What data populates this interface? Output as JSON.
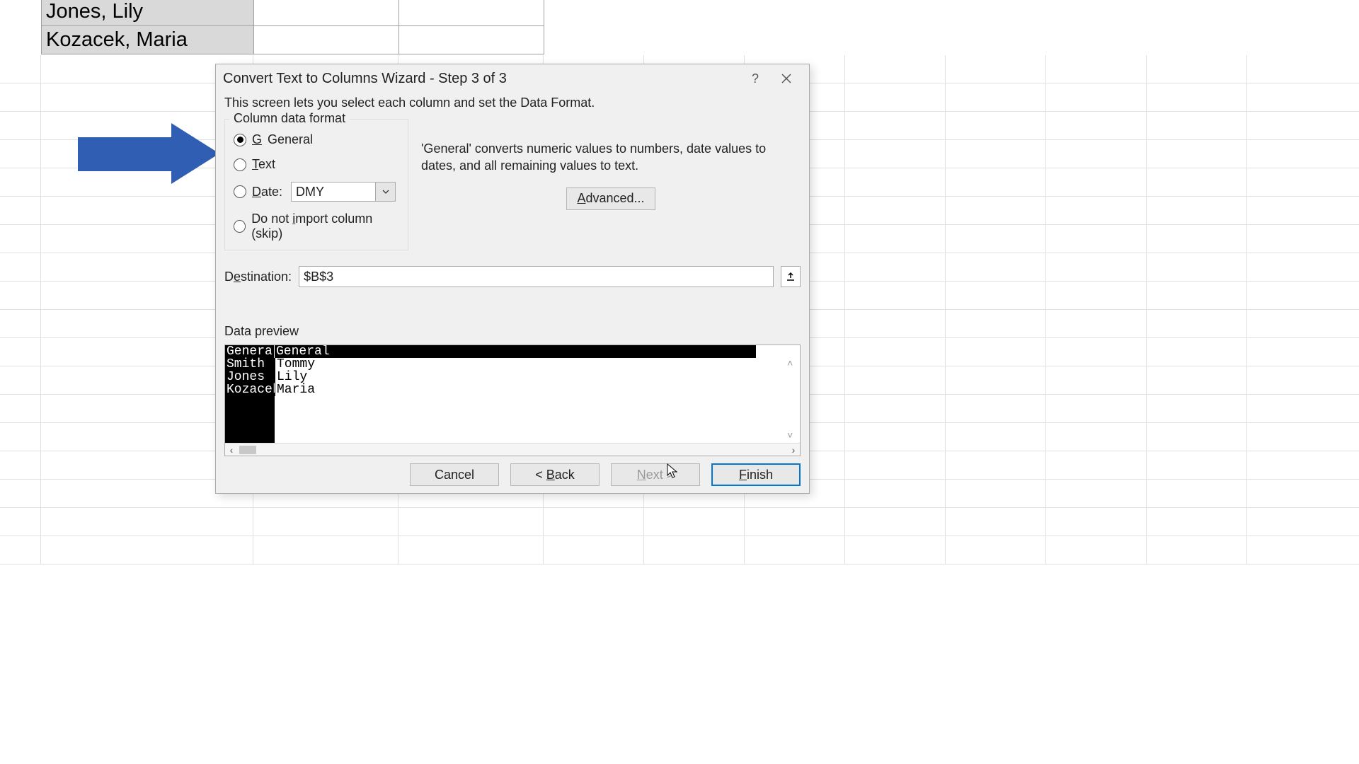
{
  "spreadsheet": {
    "rows": [
      "Jones, Lily",
      "Kozacek, Maria"
    ]
  },
  "dialog": {
    "title": "Convert Text to Columns Wizard - Step 3 of 3",
    "help_icon": "?",
    "instruction": "This screen lets you select each column and set the Data Format.",
    "format_group": {
      "legend": "Column data format",
      "options": {
        "general": "General",
        "text": "Text",
        "date": "Date:",
        "skip": "Do not import column (skip)"
      },
      "date_format": "DMY"
    },
    "hint": "'General' converts numeric values to numbers, date values to dates, and all remaining values to text.",
    "advanced": "Advanced...",
    "destination": {
      "label": "Destination:",
      "value": "$B$3"
    },
    "preview": {
      "label": "Data preview",
      "headers": [
        "General",
        "General"
      ],
      "rows": [
        [
          "Smith",
          "Tommy"
        ],
        [
          "Jones",
          "Lily"
        ],
        [
          "Kozacek",
          "Maria"
        ]
      ]
    },
    "buttons": {
      "cancel": "Cancel",
      "back": "< Back",
      "next": "Next >",
      "finish": "Finish"
    }
  }
}
